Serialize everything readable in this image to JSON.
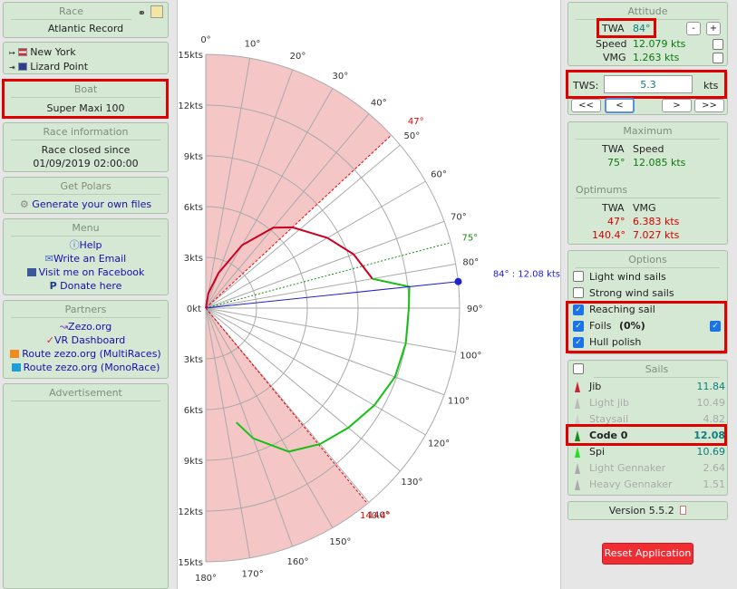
{
  "left": {
    "race": {
      "title": "Race",
      "name": "Atlantic Record"
    },
    "route": {
      "from": "New York",
      "to": "Lizard Point"
    },
    "boat": {
      "title": "Boat",
      "name": "Super Maxi 100"
    },
    "race_info": {
      "title": "Race information",
      "line1": "Race closed since",
      "line2": "01/09/2019 02:00:00"
    },
    "polars": {
      "title": "Get Polars",
      "link": "Generate your own files"
    },
    "menu": {
      "title": "Menu",
      "items": [
        "Help",
        "Write an Email",
        "Visit me on Facebook",
        "Donate here"
      ]
    },
    "partners": {
      "title": "Partners",
      "items": [
        "Zezo.org",
        "VR Dashboard",
        "Route zezo.org (MultiRaces)",
        "Route zezo.org (MonoRace)"
      ]
    },
    "ad": {
      "title": "Advertisement"
    }
  },
  "chart": {
    "speed_ticks_top": [
      "15kts",
      "12kts",
      "9kts",
      "6kts",
      "3kts"
    ],
    "zero_label": "0kt",
    "speed_ticks_bottom": [
      "3kts",
      "6kts",
      "9kts",
      "12kts",
      "15kts"
    ],
    "angle_labels": [
      "0°",
      "10°",
      "20°",
      "30°",
      "40°",
      "50°",
      "60°",
      "70°",
      "80°",
      "90°",
      "100°",
      "110°",
      "120°",
      "130°",
      "140°",
      "150°",
      "160°",
      "170°",
      "180°"
    ],
    "upwind_label": "47°",
    "downwind_label": "140.4°",
    "max_label": "75°",
    "cursor_label": "84° : 12.08 kts"
  },
  "chart_data": {
    "type": "polar",
    "r_max": 15,
    "r_ticks": [
      3,
      6,
      9,
      12,
      15
    ],
    "angle_ticks": [
      0,
      10,
      20,
      30,
      40,
      50,
      60,
      70,
      80,
      90,
      100,
      110,
      120,
      130,
      140,
      150,
      160,
      170,
      180
    ],
    "no_go_upwind": 47,
    "no_go_downwind": 140.4,
    "max_speed_twa": 75,
    "cursor": {
      "twa": 84,
      "speed": 12.08
    },
    "series": [
      {
        "color": "#cc0022",
        "points": [
          [
            0,
            0.0
          ],
          [
            10,
            0.9
          ],
          [
            20,
            2.2
          ],
          [
            30,
            4.3
          ],
          [
            40,
            6.2
          ],
          [
            47,
            7.0
          ],
          [
            60,
            8.3
          ],
          [
            70,
            9.3
          ],
          [
            80,
            10.0
          ]
        ]
      },
      {
        "color": "#16c016",
        "points": [
          [
            80,
            10.0
          ],
          [
            84,
            12.1
          ],
          [
            90,
            12.0
          ],
          [
            100,
            12.0
          ],
          [
            110,
            11.9
          ],
          [
            120,
            11.5
          ],
          [
            130,
            11.0
          ],
          [
            140,
            10.5
          ],
          [
            150,
            9.8
          ],
          [
            160,
            8.2
          ],
          [
            165,
            7.0
          ]
        ]
      }
    ]
  },
  "right": {
    "attitude": {
      "title": "Attitude",
      "twa_label": "TWA",
      "twa_value": "84°",
      "speed_label": "Speed",
      "speed_value": "12.079 kts",
      "vmg_label": "VMG",
      "vmg_value": "1.263 kts",
      "minus": "-",
      "plus": "+"
    },
    "tws": {
      "label": "TWS:",
      "value": "5.3",
      "unit": "kts",
      "buttons": [
        "<<",
        "<",
        ">",
        ">>"
      ]
    },
    "maximum": {
      "title": "Maximum",
      "twa_label": "TWA",
      "speed_label": "Speed",
      "twa": "75°",
      "speed": "12.085 kts"
    },
    "optimums": {
      "title": "Optimums",
      "twa_label": "TWA",
      "vmg_label": "VMG",
      "r1_twa": "47°",
      "r1_vmg": "6.383 kts",
      "r2_twa": "140.4°",
      "r2_vmg": "7.027 kts"
    },
    "options": {
      "title": "Options",
      "items": [
        "Light wind sails",
        "Strong wind sails",
        "Reaching sail",
        "Foils",
        "Hull polish"
      ],
      "foils_pct": "(0%)"
    },
    "sails": {
      "title": "Sails",
      "items": [
        {
          "name": "Jib",
          "value": "11.84"
        },
        {
          "name": "Light jib",
          "value": "10.49"
        },
        {
          "name": "Staysail",
          "value": "4.82"
        },
        {
          "name": "Code 0",
          "value": "12.08"
        },
        {
          "name": "Spi",
          "value": "10.69"
        },
        {
          "name": "Light Gennaker",
          "value": "2.64"
        },
        {
          "name": "Heavy Gennaker",
          "value": "1.51"
        }
      ]
    },
    "version": "Version 5.5.2",
    "reset": "Reset Application"
  }
}
